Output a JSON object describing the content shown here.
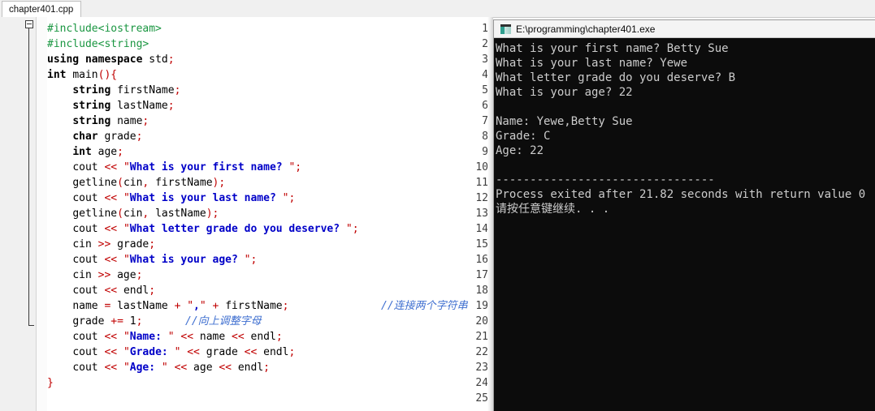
{
  "editor": {
    "tab_label": "chapter401.cpp",
    "fold_marker": "−",
    "line_numbers": [
      "1",
      "2",
      "3",
      "4",
      "5",
      "6",
      "7",
      "8",
      "9",
      "10",
      "11",
      "12",
      "13",
      "14",
      "15",
      "16",
      "17",
      "18",
      "19",
      "20",
      "21",
      "22",
      "23",
      "24",
      "25"
    ],
    "lines": [
      {
        "n": 1,
        "text": "#include<iostream>"
      },
      {
        "n": 2,
        "text": "#include<string>"
      },
      {
        "n": 3,
        "text": "using namespace std;"
      },
      {
        "n": 4,
        "text": "int main(){"
      },
      {
        "n": 5,
        "text": "    string firstName;"
      },
      {
        "n": 6,
        "text": "    string lastName;"
      },
      {
        "n": 7,
        "text": "    string name;"
      },
      {
        "n": 8,
        "text": "    char grade;"
      },
      {
        "n": 9,
        "text": "    int age;"
      },
      {
        "n": 10,
        "text": "    cout << \"What is your first name? \";"
      },
      {
        "n": 11,
        "text": "    getline(cin, firstName);"
      },
      {
        "n": 12,
        "text": "    cout << \"What is your last name? \";"
      },
      {
        "n": 13,
        "text": "    getline(cin, lastName);"
      },
      {
        "n": 14,
        "text": "    cout << \"What letter grade do you deserve? \";"
      },
      {
        "n": 15,
        "text": "    cin >> grade;"
      },
      {
        "n": 16,
        "text": "    cout << \"What is your age? \";"
      },
      {
        "n": 17,
        "text": "    cin >> age;"
      },
      {
        "n": 18,
        "text": "    cout << endl;"
      },
      {
        "n": 19,
        "text": "    name = lastName + \",\" + firstName;"
      },
      {
        "n": 20,
        "text": "    grade += 1;"
      },
      {
        "n": 21,
        "text": "    cout << \"Name: \" << name << endl;"
      },
      {
        "n": 22,
        "text": "    cout << \"Grade: \" << grade << endl;"
      },
      {
        "n": 23,
        "text": "    cout << \"Age: \" << age << endl;"
      },
      {
        "n": 24,
        "text": "}"
      },
      {
        "n": 25,
        "text": ""
      }
    ],
    "comments": [
      {
        "line": 19,
        "text": "//连接两个字符串"
      },
      {
        "line": 20,
        "text": "//向上调整字母"
      }
    ],
    "colors": {
      "preprocessor": "#1a9641",
      "string": "#0000c8",
      "operator": "#c00000",
      "comment": "#3f6fd0",
      "gutter_bg": "#f0f0f0",
      "editor_bg": "#ffffff"
    }
  },
  "console": {
    "title": "E:\\programming\\chapter401.exe",
    "icon": "console-app-icon",
    "bg": "#0c0c0c",
    "fg": "#cccccc",
    "output_lines": [
      "What is your first name? Betty Sue",
      "What is your last name? Yewe",
      "What letter grade do you deserve? B",
      "What is your age? 22",
      "",
      "Name: Yewe,Betty Sue",
      "Grade: C",
      "Age: 22",
      "",
      "--------------------------------",
      "Process exited after 21.82 seconds with return value 0",
      "请按任意键继续. . ."
    ]
  }
}
